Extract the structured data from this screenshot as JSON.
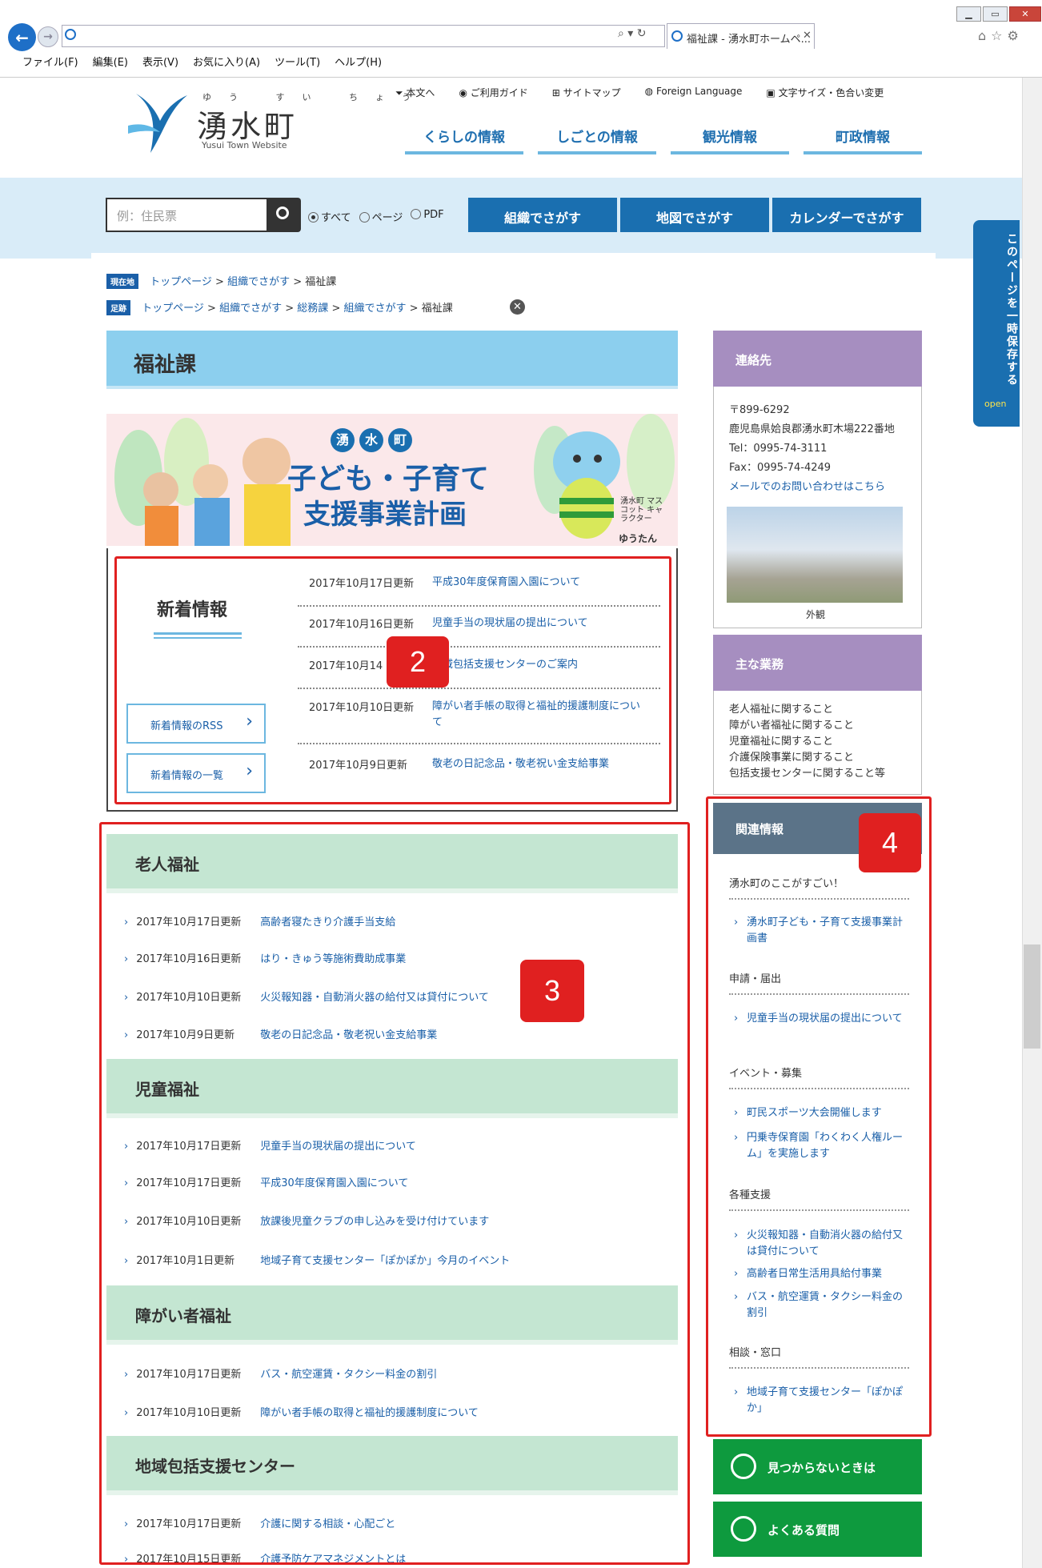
{
  "browser": {
    "tab_title": "福祉課 - 湧水町ホームペ...",
    "menu": [
      "ファイル(F)",
      "編集(E)",
      "表示(V)",
      "お気に入り(A)",
      "ツール(T)",
      "ヘルプ(H)"
    ]
  },
  "site": {
    "logo_ruby": "ゆう すい ちょう",
    "logo_text": "湧水町",
    "logo_sub": "Yusui Town Website",
    "util_links": [
      "本文へ",
      "ご利用ガイド",
      "サイトマップ",
      "Foreign Language",
      "文字サイズ・色合い変更"
    ],
    "global_nav": [
      "くらしの情報",
      "しごとの情報",
      "観光情報",
      "町政情報"
    ],
    "search": {
      "placeholder": "例：住民票",
      "radios": [
        "すべて",
        "ページ",
        "PDF"
      ],
      "selected": "すべて",
      "buttons": [
        "組織でさがす",
        "地図でさがす",
        "カレンダーでさがす"
      ]
    },
    "save_tab": "このページを一時保存する",
    "save_tab_open": "open"
  },
  "breadcrumb": {
    "current_tag": "現在地",
    "current": [
      "トップページ",
      "組織でさがす",
      "福祉課"
    ],
    "history_tag": "足跡",
    "history": [
      "トップページ",
      "組織でさがす",
      "総務課",
      "組織でさがす",
      "福祉課"
    ],
    "separator": ">"
  },
  "page_title": "福祉課",
  "banner": {
    "town": [
      "湧",
      "水",
      "町"
    ],
    "line1": "子ども・子育て",
    "line2": "支援事業計画",
    "mascot_label": "湧水町 マスコット キャラクター",
    "mascot_name": "ゆうたん"
  },
  "news": {
    "heading": "新着情報",
    "rss": "新着情報のRSS",
    "list": "新着情報の一覧",
    "items": [
      {
        "date": "2017年10月17日更新",
        "title": "平成30年度保育園入園について"
      },
      {
        "date": "2017年10月16日更新",
        "title": "児童手当の現状届の提出について"
      },
      {
        "date": "2017年10月14",
        "title": "地域包括支援センターのご案内"
      },
      {
        "date": "2017年10月10日更新",
        "title": "障がい者手帳の取得と福祉的援護制度について"
      },
      {
        "date": "2017年10月9日更新",
        "title": "敬老の日記念品・敬老祝い金支給事業"
      }
    ]
  },
  "categories": [
    {
      "title": "老人福祉",
      "items": [
        {
          "date": "2017年10月17日更新",
          "title": "高齢者寝たきり介護手当支給"
        },
        {
          "date": "2017年10月16日更新",
          "title": "はり・きゅう等施術費助成事業"
        },
        {
          "date": "2017年10月10日更新",
          "title": "火災報知器・自動消火器の給付又は貸付について"
        },
        {
          "date": "2017年10月9日更新",
          "title": "敬老の日記念品・敬老祝い金支給事業"
        }
      ]
    },
    {
      "title": "児童福祉",
      "items": [
        {
          "date": "2017年10月17日更新",
          "title": "児童手当の現状届の提出について"
        },
        {
          "date": "2017年10月17日更新",
          "title": "平成30年度保育園入園について"
        },
        {
          "date": "2017年10月10日更新",
          "title": "放課後児童クラブの申し込みを受け付けています"
        },
        {
          "date": "2017年10月1日更新",
          "title": "地域子育て支援センター「ぽかぽか」今月のイベント"
        }
      ]
    },
    {
      "title": "障がい者福祉",
      "items": [
        {
          "date": "2017年10月17日更新",
          "title": "バス・航空運賃・タクシー料金の割引"
        },
        {
          "date": "2017年10月10日更新",
          "title": "障がい者手帳の取得と福祉的援護制度について"
        }
      ]
    },
    {
      "title": "地域包括支援センター",
      "items": [
        {
          "date": "2017年10月17日更新",
          "title": "介護に関する相談・心配ごと"
        },
        {
          "date": "2017年10月15日更新",
          "title": "介護予防ケアマネジメントとは"
        }
      ]
    }
  ],
  "sidebar": {
    "contact": {
      "heading": "連絡先",
      "zip": "〒899-6292",
      "address": "鹿児島県姶良郡湧水町木場222番地",
      "tel": "Tel：0995-74-3111",
      "fax": "Fax：0995-74-4249",
      "mail_link": "メールでのお問い合わせはこちら",
      "photo_caption": "外観"
    },
    "business": {
      "heading": "主な業務",
      "items": [
        "老人福祉に関すること",
        "障がい者福祉に関すること",
        "児童福祉に関すること",
        "介護保険事業に関すること",
        "包括支援センターに関すること等"
      ]
    },
    "related": {
      "heading": "関連情報",
      "groups": [
        {
          "title": "湧水町のここがすごい！",
          "links": [
            "湧水町子ども・子育て支援事業計画書"
          ]
        },
        {
          "title": "申請・届出",
          "links": [
            "児童手当の現状届の提出について"
          ]
        },
        {
          "title": "イベント・募集",
          "links": [
            "町民スポーツ大会開催します",
            "円乗寺保育園「わくわく人権ルーム」を実施します"
          ]
        },
        {
          "title": "各種支援",
          "links": [
            "火災報知器・自動消火器の給付又は貸付について",
            "高齢者日常生活用具給付事業",
            "バス・航空運賃・タクシー料金の割引"
          ]
        },
        {
          "title": "相談・窓口",
          "links": [
            "地域子育て支援センター「ぽかぽか」"
          ]
        }
      ]
    },
    "notfound": "見つからないときは",
    "faq": "よくある質問"
  },
  "annotations": [
    "2",
    "3",
    "4"
  ],
  "colors": {
    "accent": "#1a6fb0",
    "highlight": "#e02020",
    "news_line": "#6cb7e0",
    "cat_bg": "#c4e6d2",
    "contact_head": "#a68ec0",
    "related_head": "#5b7388",
    "green": "#0e9a3e"
  }
}
